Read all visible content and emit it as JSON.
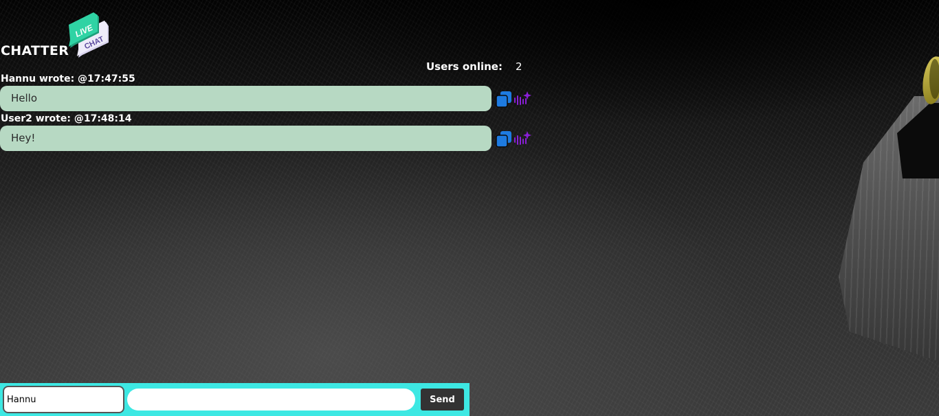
{
  "app": {
    "title": "CHATTER",
    "logo_text_top": "LIVE",
    "logo_text_bottom": "CHAT",
    "logo_colors": {
      "top": "#2cc79a",
      "bottom": "#e6e2f4",
      "bottom_text": "#5b4a9e"
    }
  },
  "users_online": {
    "label": "Users online:",
    "count": "2"
  },
  "messages": [
    {
      "header": "Hannu wrote: @17:47:55",
      "text": "Hello"
    },
    {
      "header": "User2 wrote: @17:48:14",
      "text": "Hey!"
    }
  ],
  "message_actions": {
    "copy_icon": "copy-icon",
    "speak_icon": "text-to-speech-icon",
    "copy_color": "#1e7be0",
    "speak_color": "#8a1fd8"
  },
  "composer": {
    "name_value": "Hannu",
    "message_value": "",
    "send_label": "Send",
    "background": "#3de8e3"
  },
  "colors": {
    "bubble": "#b7d9c3"
  }
}
